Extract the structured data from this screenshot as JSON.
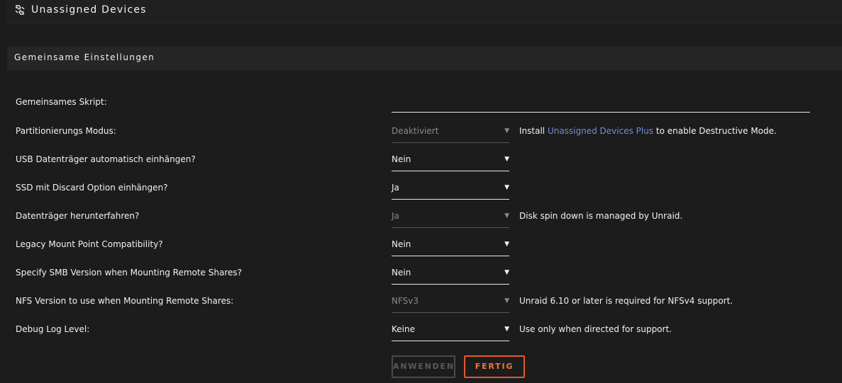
{
  "header": {
    "title": "Unassigned Devices",
    "icon": "chain-link-icon"
  },
  "section": {
    "title": "Gemeinsame Einstellungen"
  },
  "settings": [
    {
      "label": "Gemeinsames Skript:",
      "type": "text",
      "value": ""
    },
    {
      "label": "Partitionierungs Modus:",
      "type": "select",
      "value": "Deaktiviert",
      "disabled": true,
      "note_prefix": "Install ",
      "note_link": "Unassigned Devices Plus",
      "note_suffix": " to enable Destructive Mode."
    },
    {
      "label": "USB Datenträger automatisch einhängen?",
      "type": "select",
      "value": "Nein"
    },
    {
      "label": "SSD mit Discard Option einhängen?",
      "type": "select",
      "value": "Ja"
    },
    {
      "label": "Datenträger herunterfahren?",
      "type": "select",
      "value": "Ja",
      "disabled": true,
      "note": "Disk spin down is managed by Unraid."
    },
    {
      "label": "Legacy Mount Point Compatibility?",
      "type": "select",
      "value": "Nein"
    },
    {
      "label": "Specify SMB Version when Mounting Remote Shares?",
      "type": "select",
      "value": "Nein"
    },
    {
      "label": "NFS Version to use when Mounting Remote Shares:",
      "type": "select",
      "value": "NFSv3",
      "disabled": true,
      "note": "Unraid 6.10 or later is required for NFSv4 support."
    },
    {
      "label": "Debug Log Level:",
      "type": "select",
      "value": "Keine",
      "note": "Use only when directed for support."
    }
  ],
  "buttons": {
    "apply": "ANWENDEN",
    "done": "FERTIG"
  },
  "arrow_glyph": "▼",
  "colors": {
    "background": "#1c1c1c",
    "link": "#6e8fd8",
    "accent": "#e25a2c",
    "disabled_text": "#8a8a8a"
  }
}
